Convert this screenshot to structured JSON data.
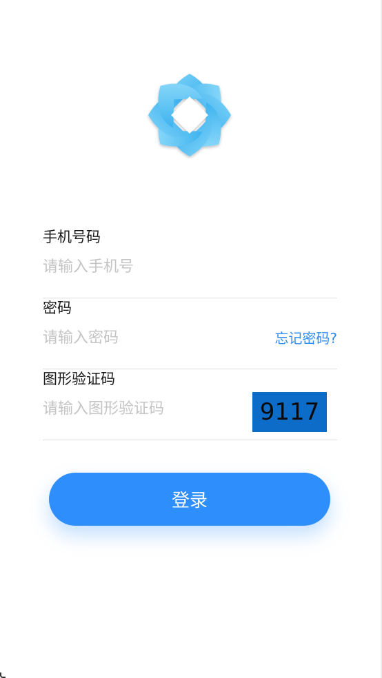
{
  "logo": {
    "icon": "flower-logo-icon",
    "color": "#3fb4ef"
  },
  "form": {
    "phone": {
      "label": "手机号码",
      "placeholder": "请输入手机号",
      "value": ""
    },
    "password": {
      "label": "密码",
      "placeholder": "请输入密码",
      "value": "",
      "forgot_label": "忘记密码?"
    },
    "captcha": {
      "label": "图形验证码",
      "placeholder": "请输入图形验证码",
      "value": "",
      "code": "9117"
    }
  },
  "login_button": {
    "label": "登录",
    "color": "#2e8efc"
  },
  "colors": {
    "accent": "#2e8cf0",
    "captcha_bg": "#0d6cc7"
  }
}
